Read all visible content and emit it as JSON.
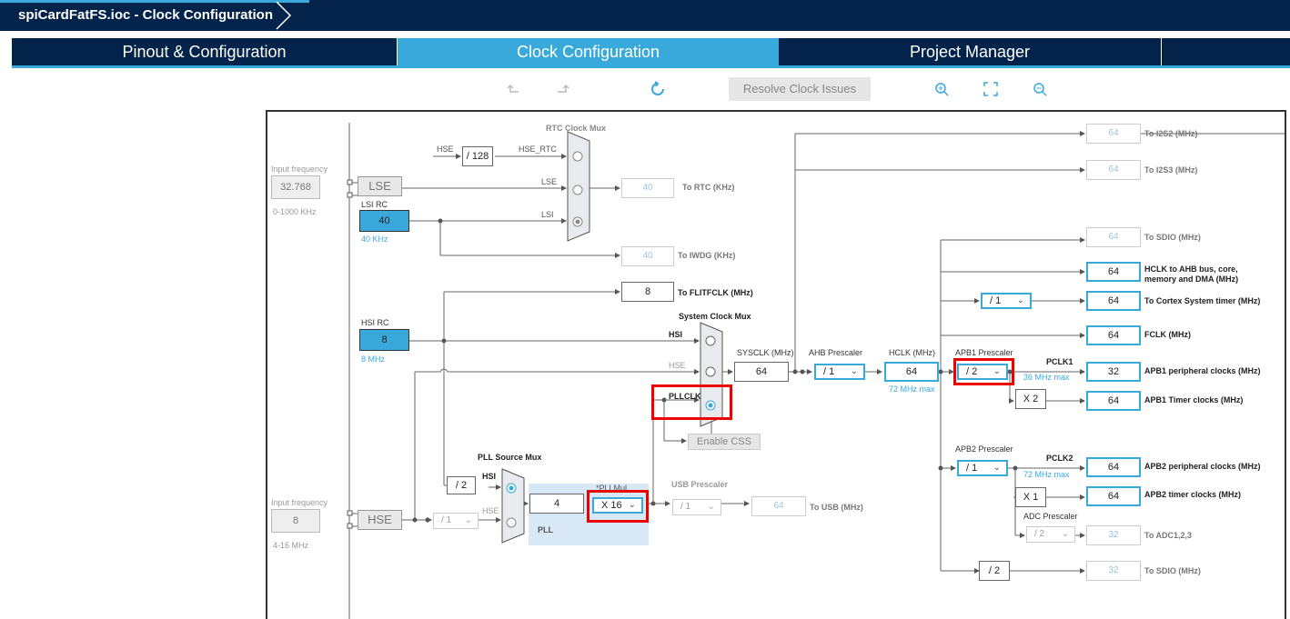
{
  "window": {
    "title": "spiCardFatFS.ioc - Clock Configuration"
  },
  "tabs": [
    {
      "label": "Pinout & Configuration"
    },
    {
      "label": "Clock Configuration"
    },
    {
      "label": "Project Manager"
    }
  ],
  "toolbar": {
    "resolve_label": "Resolve Clock Issues"
  },
  "colors": {
    "navy": "#03234b",
    "accent": "#39a9dc",
    "highlight": "#e00000"
  },
  "left": {
    "lse_input_label": "Input frequency",
    "lse_value": "32.768",
    "lse_range": "0-1000 KHz",
    "hse_input_label": "Input frequency",
    "hse_value": "8",
    "hse_range": "4-16 MHz"
  },
  "sources": {
    "lse": "LSE",
    "lsi_rc_label": "LSI RC",
    "lsi_value": "40",
    "lsi_freq": "40 KHz",
    "hsi_rc_label": "HSI RC",
    "hsi_value": "8",
    "hsi_freq": "8 MHz",
    "hse": "HSE"
  },
  "rtc": {
    "mux_title": "RTC Clock Mux",
    "hse_label": "HSE",
    "div128": "/ 128",
    "hse_rtc_label": "HSE_RTC",
    "lse_label": "LSE",
    "lsi_label": "LSI",
    "rtc_value": "40",
    "rtc_label": "To RTC (KHz)",
    "iwdg_value": "40",
    "iwdg_label": "To IWDG (KHz)"
  },
  "flitf": {
    "value": "8",
    "label": "To FLITFCLK (MHz)"
  },
  "sysmux": {
    "title": "System Clock Mux",
    "hsi": "HSI",
    "hse": "HSE",
    "pllclk": "PLLCLK",
    "enable_css": "Enable CSS"
  },
  "pll": {
    "src_mux_title": "PLL Source Mux",
    "div2": "/ 2",
    "hsi": "HSI",
    "hse": "HSE",
    "hse_div": "/ 1",
    "value": "4",
    "mul_label": "*PLLMul",
    "mul": "X 16",
    "label": "PLL"
  },
  "usb": {
    "title": "USB Prescaler",
    "div": "/ 1",
    "value": "64",
    "label": "To USB (MHz)"
  },
  "sysclk": {
    "label": "SYSCLK (MHz)",
    "value": "64"
  },
  "ahb": {
    "label": "AHB Prescaler",
    "div": "/ 1"
  },
  "hclk": {
    "label": "HCLK (MHz)",
    "value": "64",
    "max": "72 MHz max"
  },
  "apb1": {
    "label": "APB1 Prescaler",
    "div": "/ 2",
    "pclk": "PCLK1",
    "max": "36 MHz max",
    "x2": "X 2"
  },
  "apb2": {
    "label": "APB2 Prescaler",
    "div": "/ 1",
    "pclk": "PCLK2",
    "max": "72 MHz max",
    "x1": "X 1"
  },
  "adc": {
    "label": "ADC Prescaler",
    "div": "/ 2",
    "value": "32",
    "out": "To ADC1,2,3"
  },
  "sdio2": {
    "div": "/ 2",
    "value": "32",
    "label": "To SDIO (MHz)"
  },
  "outputs": [
    {
      "value": "64",
      "label": "To I2S2 (MHz)"
    },
    {
      "value": "64",
      "label": "To I2S3 (MHz)"
    },
    {
      "value": "64",
      "label": "To SDIO (MHz)"
    },
    {
      "value": "64",
      "label": "HCLK to AHB bus, core, memory and DMA (MHz)"
    },
    {
      "value": "64",
      "label": "To Cortex System timer (MHz)",
      "div": "/ 1"
    },
    {
      "value": "64",
      "label": "FCLK (MHz)"
    },
    {
      "value": "32",
      "label": "APB1 peripheral clocks (MHz)"
    },
    {
      "value": "64",
      "label": "APB1 Timer clocks (MHz)"
    },
    {
      "value": "64",
      "label": "APB2 peripheral clocks (MHz)"
    },
    {
      "value": "64",
      "label": "APB2 timer clocks (MHz)"
    }
  ]
}
